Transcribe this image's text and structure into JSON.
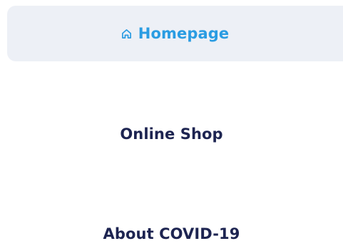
{
  "nav": {
    "items": [
      {
        "label": "Homepage",
        "icon": "home-icon",
        "active": true
      },
      {
        "label": "Online Shop",
        "active": false
      },
      {
        "label": "About COVID-19",
        "active": false
      }
    ]
  },
  "colors": {
    "active_text": "#2a9ce2",
    "active_bg": "#edf0f6",
    "text": "#1d2451",
    "background": "#ffffff"
  }
}
